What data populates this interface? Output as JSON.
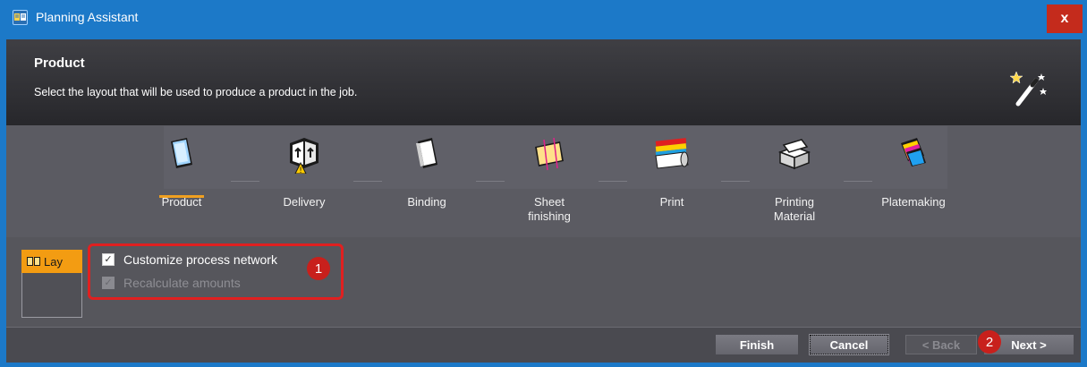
{
  "window": {
    "title": "Planning Assistant",
    "close_label": "x"
  },
  "header": {
    "title": "Product",
    "subtitle": "Select the layout that will be used to produce a product in the job.",
    "icon": "magic-wand-icon"
  },
  "steps": [
    {
      "label": "Product",
      "icon": "product-icon",
      "active": true
    },
    {
      "label": "Delivery",
      "icon": "delivery-icon",
      "active": false
    },
    {
      "label": "Binding",
      "icon": "binding-icon",
      "active": false
    },
    {
      "label": "Sheet\nfinishing",
      "icon": "sheet-finishing-icon",
      "active": false
    },
    {
      "label": "Print",
      "icon": "print-icon",
      "active": false
    },
    {
      "label": "Printing\nMaterial",
      "icon": "printing-material-icon",
      "active": false
    },
    {
      "label": "Platemaking",
      "icon": "platemaking-icon",
      "active": false
    }
  ],
  "side_tab": {
    "label": "Lay",
    "icon": "layout-icon"
  },
  "options": {
    "customize": {
      "label": "Customize process network",
      "checked": true,
      "enabled": true
    },
    "recalculate": {
      "label": "Recalculate amounts",
      "checked": true,
      "enabled": false
    }
  },
  "annotations": {
    "badge1": "1",
    "badge2": "2"
  },
  "footer": {
    "finish_label": "Finish",
    "cancel_label": "Cancel",
    "back_label": "< Back",
    "next_label": "Next >"
  },
  "colors": {
    "titlebar": "#1c79c8",
    "accent": "#f39c12",
    "highlight": "#e02020"
  }
}
